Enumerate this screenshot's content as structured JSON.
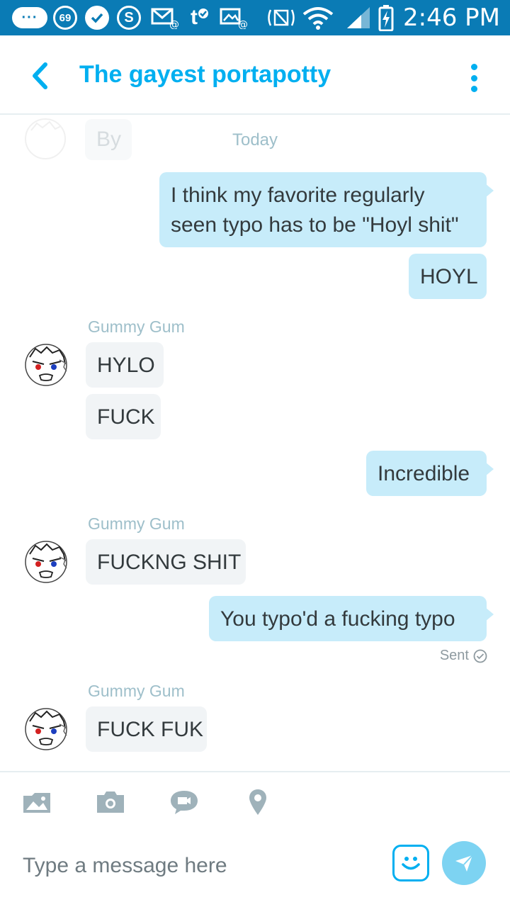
{
  "status_bar": {
    "badge": "···",
    "notification_count": "69",
    "skype_letter": "S",
    "tumblr_letter": "t",
    "time": "2:46 PM"
  },
  "header": {
    "title": "The gayest portapotty"
  },
  "chat": {
    "faded_text": "By",
    "date_divider": "Today",
    "messages": [
      {
        "direction": "outgoing",
        "lines": [
          "I think my favorite regularly",
          "seen typo has to be \"Hoyl shit\""
        ]
      },
      {
        "direction": "outgoing",
        "text": "HOYL"
      },
      {
        "direction": "incoming",
        "sender": "Gummy Gum",
        "text": "HYLO"
      },
      {
        "direction": "incoming",
        "text": "FUCK"
      },
      {
        "direction": "outgoing",
        "text": "Incredible"
      },
      {
        "direction": "incoming",
        "sender": "Gummy Gum",
        "text": "FUCKNG SHIT"
      },
      {
        "direction": "outgoing",
        "text": "You typo'd a fucking typo",
        "status": "Sent"
      },
      {
        "direction": "incoming",
        "sender": "Gummy Gum",
        "text": "FUCK FUK"
      }
    ]
  },
  "composer": {
    "placeholder": "Type a message here",
    "tools": [
      "media-icon",
      "camera-icon",
      "video-message-icon",
      "location-icon"
    ]
  },
  "colors": {
    "status_bar": "#0a7bb5",
    "accent": "#00aff0",
    "outgoing_bubble": "#c7ecfa",
    "incoming_bubble": "#f1f4f6",
    "sender_name": "#9ebfca"
  }
}
